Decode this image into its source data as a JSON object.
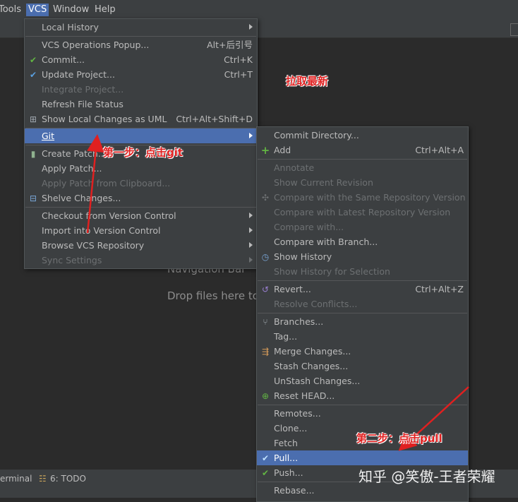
{
  "menubar": {
    "tools": "Tools",
    "vcs": "VCS",
    "window": "Window",
    "help": "Help"
  },
  "editor": {
    "hint_nav": "Navigation Bar",
    "hint_drop": "Drop files here to"
  },
  "bottombar": {
    "terminal": "erminal",
    "todo": "6: TODO"
  },
  "vcs_menu": {
    "items": [
      {
        "label": "Local History",
        "shortcut": ""
      },
      {
        "label": "VCS Operations Popup...",
        "shortcut": "Alt+后引号"
      },
      {
        "label": "Commit...",
        "shortcut": "Ctrl+K"
      },
      {
        "label": "Update Project...",
        "shortcut": "Ctrl+T"
      },
      {
        "label": "Integrate Project...",
        "shortcut": ""
      },
      {
        "label": "Refresh File Status",
        "shortcut": ""
      },
      {
        "label": "Show Local Changes as UML",
        "shortcut": "Ctrl+Alt+Shift+D"
      },
      {
        "label": "Git",
        "shortcut": ""
      },
      {
        "label": "Create Patch...",
        "shortcut": ""
      },
      {
        "label": "Apply Patch...",
        "shortcut": ""
      },
      {
        "label": "Apply Patch from Clipboard...",
        "shortcut": ""
      },
      {
        "label": "Shelve Changes...",
        "shortcut": ""
      },
      {
        "label": "Checkout from Version Control",
        "shortcut": ""
      },
      {
        "label": "Import into Version Control",
        "shortcut": ""
      },
      {
        "label": "Browse VCS Repository",
        "shortcut": ""
      },
      {
        "label": "Sync Settings",
        "shortcut": ""
      }
    ]
  },
  "git_menu": {
    "items": [
      {
        "label": "Commit Directory...",
        "shortcut": ""
      },
      {
        "label": "Add",
        "shortcut": "Ctrl+Alt+A"
      },
      {
        "label": "Annotate",
        "shortcut": ""
      },
      {
        "label": "Show Current Revision",
        "shortcut": ""
      },
      {
        "label": "Compare with the Same Repository Version",
        "shortcut": ""
      },
      {
        "label": "Compare with Latest Repository Version",
        "shortcut": ""
      },
      {
        "label": "Compare with...",
        "shortcut": ""
      },
      {
        "label": "Compare with Branch...",
        "shortcut": ""
      },
      {
        "label": "Show History",
        "shortcut": ""
      },
      {
        "label": "Show History for Selection",
        "shortcut": ""
      },
      {
        "label": "Revert...",
        "shortcut": "Ctrl+Alt+Z"
      },
      {
        "label": "Resolve Conflicts...",
        "shortcut": ""
      },
      {
        "label": "Branches...",
        "shortcut": ""
      },
      {
        "label": "Tag...",
        "shortcut": ""
      },
      {
        "label": "Merge Changes...",
        "shortcut": ""
      },
      {
        "label": "Stash Changes...",
        "shortcut": ""
      },
      {
        "label": "UnStash Changes...",
        "shortcut": ""
      },
      {
        "label": "Reset HEAD...",
        "shortcut": ""
      },
      {
        "label": "Remotes...",
        "shortcut": ""
      },
      {
        "label": "Clone...",
        "shortcut": ""
      },
      {
        "label": "Fetch",
        "shortcut": ""
      },
      {
        "label": "Pull...",
        "shortcut": ""
      },
      {
        "label": "Push...",
        "shortcut": ""
      },
      {
        "label": "Rebase...",
        "shortcut": ""
      }
    ]
  },
  "annotations": {
    "pull_latest": "拉取最新",
    "step1": "第一步：点击git",
    "step2": "第二步：点击pull",
    "watermark": "知乎 @笑傲-王者荣耀"
  },
  "colors": {
    "selection": "#4b6eaf",
    "annotation": "#e02020",
    "menu_bg": "#3c3f41"
  }
}
